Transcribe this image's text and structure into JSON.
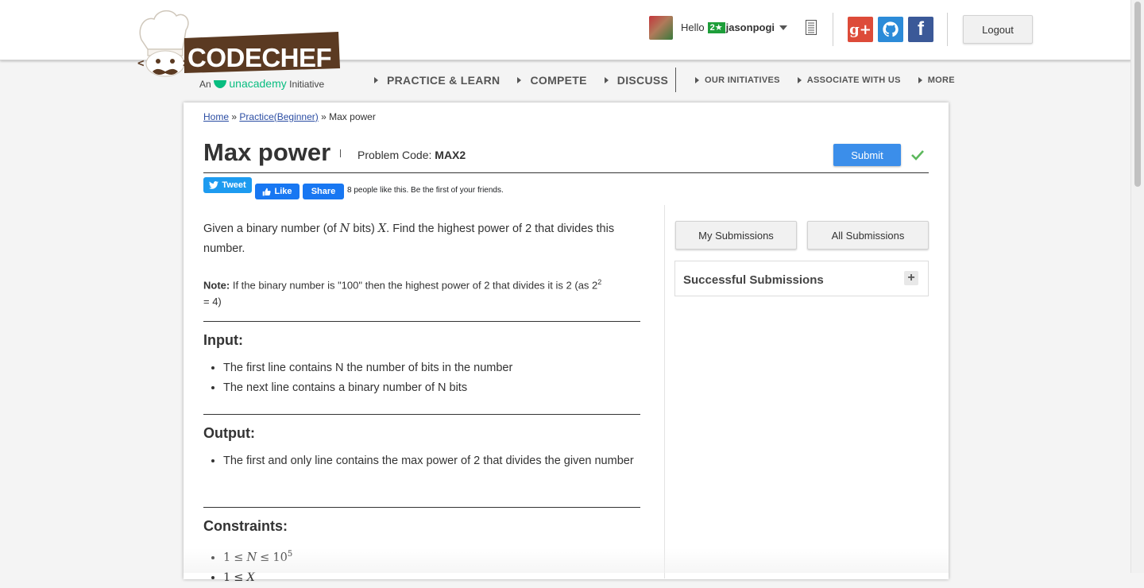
{
  "header": {
    "logo_text": "CODECHEF",
    "logo_sub_prefix": "An",
    "logo_sub_brand": "unacademy",
    "logo_sub_suffix": "Initiative",
    "greeting": "Hello",
    "rating_badge": "2★",
    "username": "jasonpogi",
    "logout_label": "Logout",
    "social_icons": [
      "google-plus-icon",
      "github-icon",
      "facebook-icon"
    ]
  },
  "nav": {
    "main": [
      "PRACTICE & LEARN",
      "COMPETE",
      "DISCUSS"
    ],
    "sub": [
      "OUR INITIATIVES",
      "ASSOCIATE WITH US",
      "MORE"
    ]
  },
  "breadcrumb": {
    "home": "Home",
    "sep1": "»",
    "practice": "Practice(Beginner)",
    "sep2": "»",
    "current": "Max power"
  },
  "problem": {
    "title": "Max power",
    "code_label": "Problem Code:",
    "code": "MAX2",
    "submit_label": "Submit"
  },
  "social_share": {
    "tweet": "Tweet",
    "like": "Like",
    "share": "Share",
    "like_text": "8 people like this. Be the first of your friends."
  },
  "statement": {
    "p1_a": "Given a binary number (of",
    "p1_var_n": "N",
    "p1_b": "bits)",
    "p1_var_x": "X",
    "p1_c": ". Find the highest power of 2 that divides this number.",
    "note_label": "Note:",
    "note_text": "If the binary number is \"100\" then the highest power of 2 that divides it is 2 (as 2",
    "note_sup": "2",
    "note_end": "= 4)"
  },
  "input_section": {
    "heading": "Input:",
    "items": [
      "The first line contains N the number of bits in the number",
      "The next line contains a binary number of N bits"
    ]
  },
  "output_section": {
    "heading": "Output:",
    "items": [
      "The first and only line contains the max power of 2 that divides the given number"
    ]
  },
  "constraints_section": {
    "heading": "Constraints:",
    "c1_lhs": "1",
    "c1_op": "≤",
    "c1_var": "N",
    "c1_op2": "≤",
    "c1_base": "10",
    "c1_exp": "5",
    "c2_lhs": "1",
    "c2_op": "≤",
    "c2_var": "X"
  },
  "sidebar": {
    "my_submissions": "My Submissions",
    "all_submissions": "All Submissions",
    "successful_title": "Successful Submissions",
    "expand": "+"
  },
  "colors": {
    "accent": "#3b8eea",
    "brand_brown": "#5b3a22",
    "success_green": "#5cb85c"
  }
}
